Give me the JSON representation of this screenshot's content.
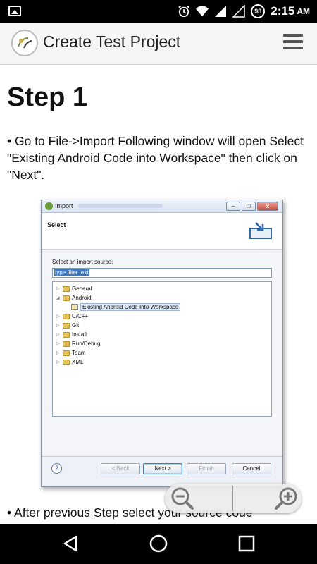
{
  "status_bar": {
    "time": "2:15",
    "ampm": "AM",
    "badge": "98"
  },
  "app_bar": {
    "title": "Create Test Project"
  },
  "content": {
    "step_title": "Step 1",
    "step_text": "• Go to File->Import Following window will open Select \"Existing Android Code into Workspace\" then click on \"Next\".",
    "next_text": "• After previous Step select your source code"
  },
  "dialog": {
    "title": "Import",
    "header": "Select",
    "source_label": "Select an import source:",
    "filter_placeholder": "type filter text",
    "tree": [
      {
        "label": "General",
        "expanded": false
      },
      {
        "label": "Android",
        "expanded": true
      },
      {
        "label": "Existing Android Code Into Workspace",
        "child": true
      },
      {
        "label": "C/C++",
        "expanded": false
      },
      {
        "label": "Git",
        "expanded": false
      },
      {
        "label": "Install",
        "expanded": false
      },
      {
        "label": "Run/Debug",
        "expanded": false
      },
      {
        "label": "Team",
        "expanded": false
      },
      {
        "label": "XML",
        "expanded": false
      }
    ],
    "buttons": {
      "back": "< Back",
      "next": "Next >",
      "finish": "Finish",
      "cancel": "Cancel"
    },
    "help": "?"
  },
  "icons": {
    "status_left": "image-icon",
    "alarm": "alarm-icon",
    "wifi": "wifi-icon",
    "signal": "signal-icon",
    "menu": "hamburger-menu-icon",
    "zoom_out": "zoom-out-icon",
    "zoom_in": "zoom-in-icon",
    "back": "back-icon",
    "home": "home-icon",
    "recents": "recents-icon"
  }
}
